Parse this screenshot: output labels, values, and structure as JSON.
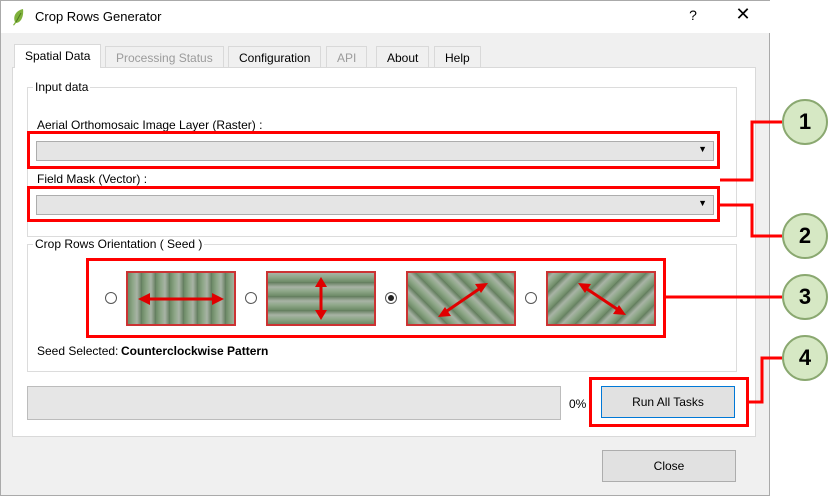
{
  "window": {
    "title": "Crop Rows Generator",
    "help_glyph": "?",
    "close_glyph": "✕"
  },
  "tabs": [
    {
      "label": "Spatial Data",
      "state": "active"
    },
    {
      "label": "Processing Status",
      "state": "disabled"
    },
    {
      "label": "Configuration",
      "state": "normal"
    },
    {
      "label": "API",
      "state": "disabled"
    },
    {
      "label": "About",
      "state": "normal"
    },
    {
      "label": "Help",
      "state": "normal"
    }
  ],
  "input_data": {
    "legend": "Input data",
    "raster_label": "Aerial Orthomosaic Image Layer (Raster) :",
    "raster_value": "",
    "vector_label": "Field Mask (Vector) :",
    "vector_value": ""
  },
  "orientation": {
    "legend": "Crop Rows Orientation ( Seed )",
    "seeds": [
      {
        "icon": "horizontal-arrow-icon",
        "checked": false
      },
      {
        "icon": "vertical-arrow-icon",
        "checked": false
      },
      {
        "icon": "diagonal-up-arrow-icon",
        "checked": true
      },
      {
        "icon": "diagonal-down-arrow-icon",
        "checked": false
      }
    ],
    "selected_prefix": "Seed Selected:",
    "selected_value": "Counterclockwise Pattern"
  },
  "progress": {
    "percent": 0,
    "label": "0%"
  },
  "buttons": {
    "run_all": "Run All Tasks",
    "close": "Close"
  },
  "callouts": [
    "1",
    "2",
    "3",
    "4"
  ],
  "colors": {
    "annotation_red": "#ff0000",
    "callout_fill": "#d6e8c4",
    "arrow_red": "#e00000"
  }
}
